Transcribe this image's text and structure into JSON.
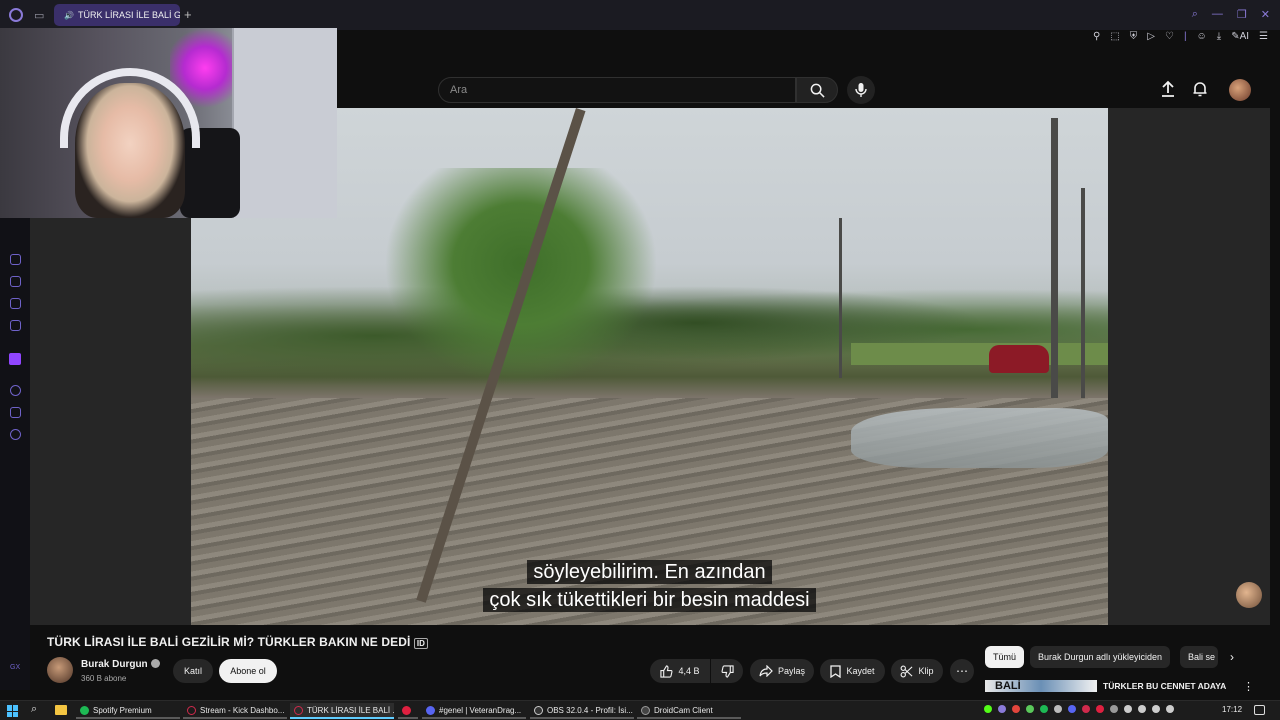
{
  "browser": {
    "tab_title": "TÜRK LİRASI İLE BALİ GEZİLİR Mİ?",
    "ai_label": "AI"
  },
  "youtube": {
    "search": {
      "placeholder": "Ara"
    },
    "video": {
      "subtitle_line1": "söyleyebilirim. En azından",
      "subtitle_line2": "çok sık tükettikleri bir besin maddesi",
      "title": "TÜRK LİRASI İLE BALİ GEZİLİR Mİ? TÜRKLER BAKIN NE DEDİ"
    },
    "channel": {
      "name": "Burak Durgun",
      "subscribers": "360 B abone",
      "join_label": "Katıl",
      "subscribe_label": "Abone ol"
    },
    "actions": {
      "like_count": "4,4 B",
      "share_label": "Paylaş",
      "save_label": "Kaydet",
      "clip_label": "Klip"
    },
    "chips": [
      "Tümü",
      "Burak Durgun adlı yükleyiciden",
      "Bali se"
    ],
    "recommendation": {
      "title": "TÜRKLER BU CENNET ADAYA AKIN EDİYOR: BALİ",
      "thumb_text": "BALİ"
    }
  },
  "taskbar": {
    "apps": [
      {
        "label": "Spotify Premium",
        "color": "#1db954"
      },
      {
        "label": "Stream - Kick Dashbo...",
        "color": "#53fc18"
      },
      {
        "label": "TÜRK LİRASI İLE BALİ ...",
        "color": "#8a7ad8"
      },
      {
        "label": "",
        "color": "#ff0033"
      },
      {
        "label": "#genel | VeteranDrag...",
        "color": "#5865f2"
      },
      {
        "label": "OBS 32.0.4 - Profil: İsi...",
        "color": "#cccccc"
      },
      {
        "label": "DroidCam Client",
        "color": "#333333"
      }
    ],
    "clock": "17:12"
  },
  "colors": {
    "youtube_bg": "#0f0f0f",
    "opera_accent": "#8a7ad8",
    "youtube_red": "#ff0033"
  }
}
